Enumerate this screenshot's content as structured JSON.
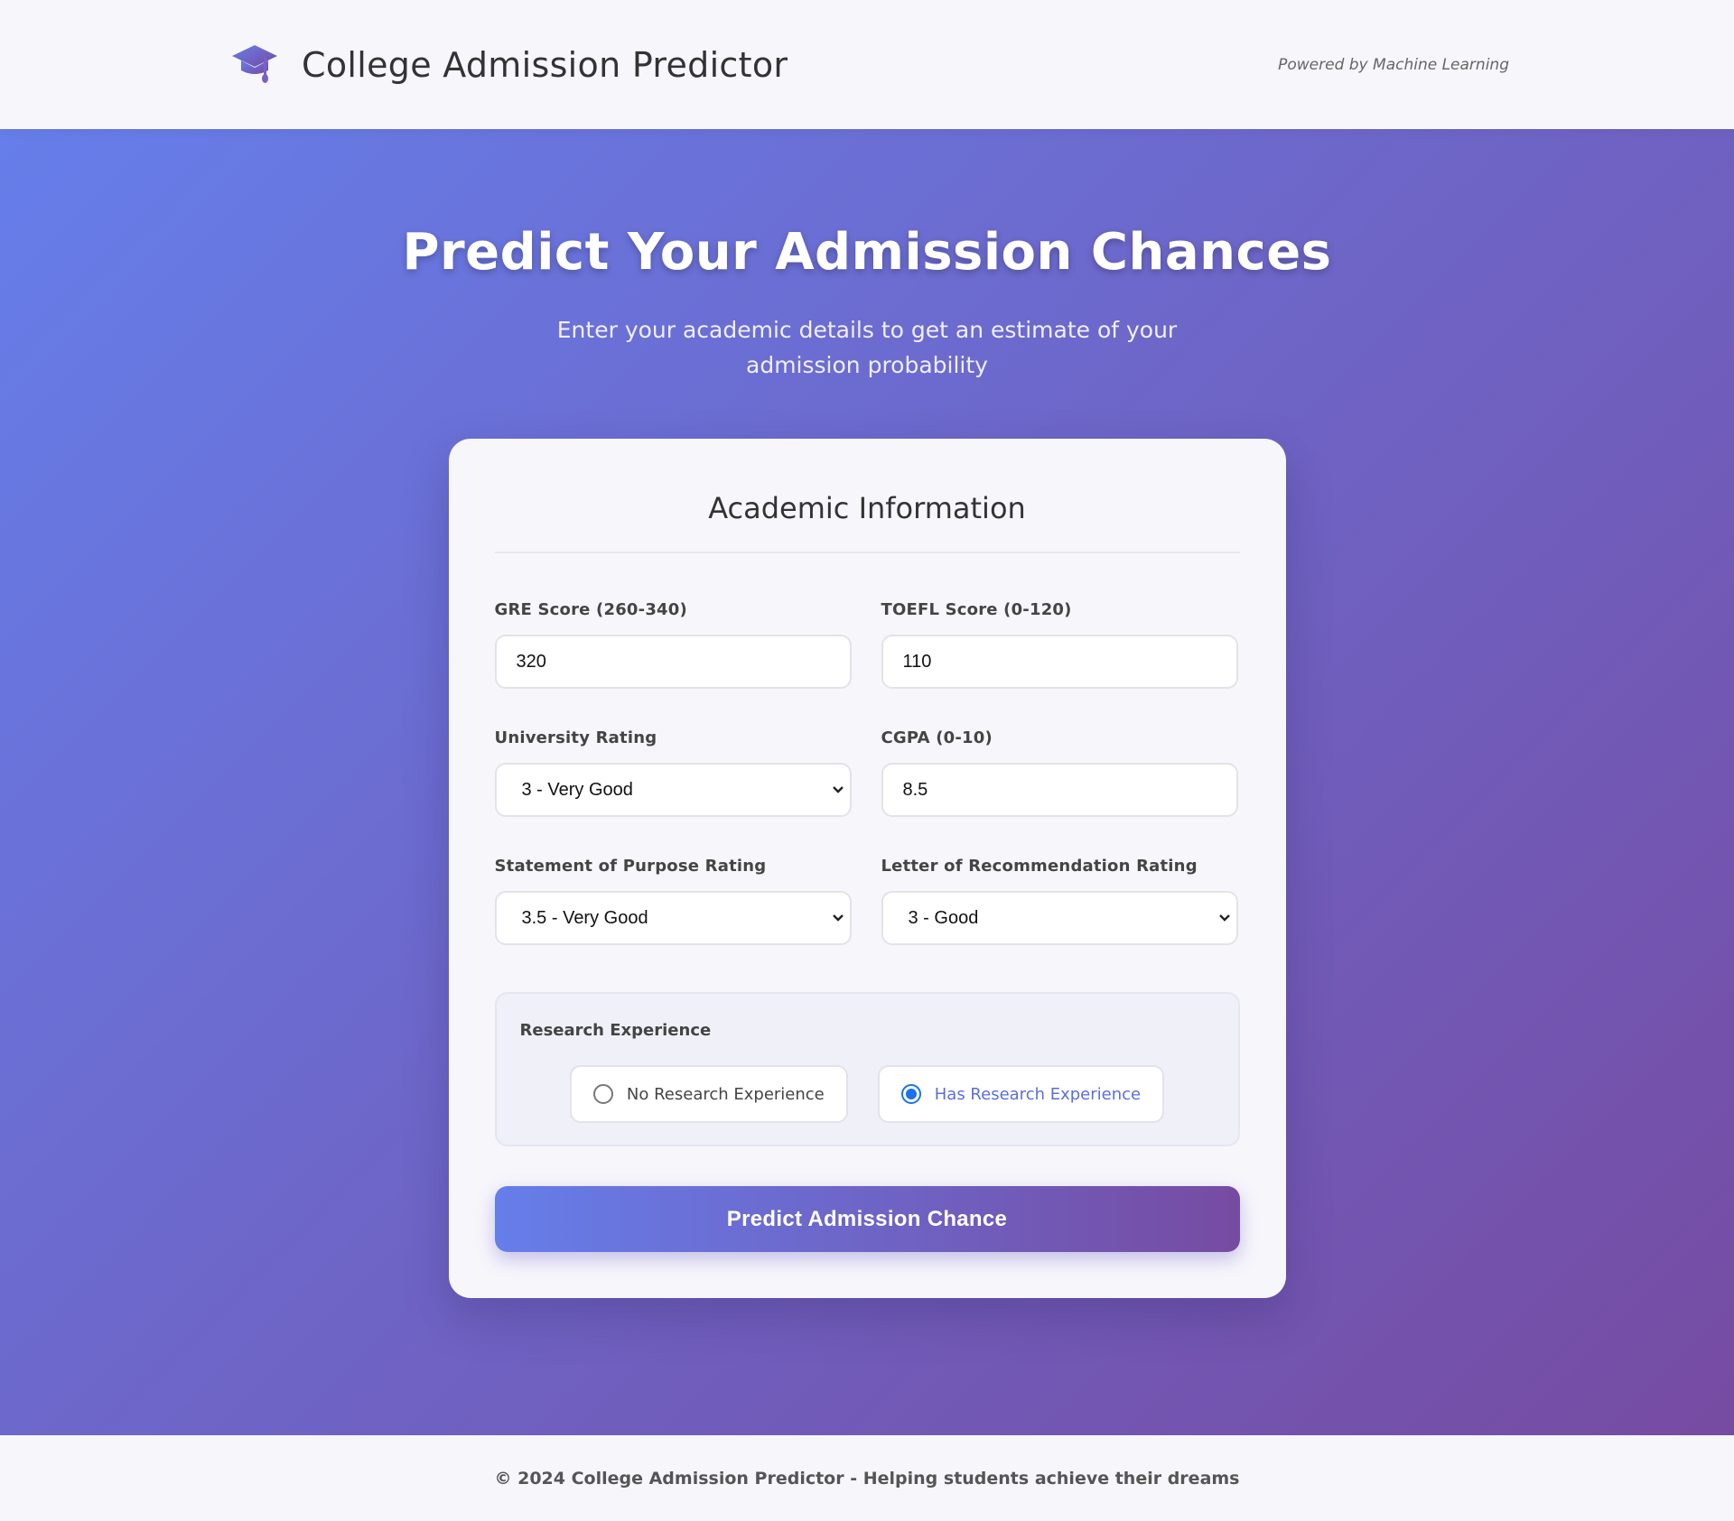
{
  "header": {
    "title": "College Admission Predictor",
    "powered": "Powered by Machine Learning",
    "icon": "graduation-cap-icon"
  },
  "hero": {
    "title": "Predict Your Admission Chances",
    "subtitle": "Enter your academic details to get an estimate of your admission probability"
  },
  "form": {
    "title": "Academic Information",
    "gre": {
      "label": "GRE Score (260-340)",
      "value": "320"
    },
    "toefl": {
      "label": "TOEFL Score (0-120)",
      "value": "110"
    },
    "university_rating": {
      "label": "University Rating",
      "value": "3 - Very Good"
    },
    "cgpa": {
      "label": "CGPA (0-10)",
      "value": "8.5"
    },
    "sop": {
      "label": "Statement of Purpose Rating",
      "value": "3.5 - Very Good"
    },
    "lor": {
      "label": "Letter of Recommendation Rating",
      "value": "3 - Good"
    },
    "research": {
      "label": "Research Experience",
      "no_label": "No Research Experience",
      "yes_label": "Has Research Experience",
      "selected": "yes"
    },
    "submit_label": "Predict Admission Chance"
  },
  "footer": {
    "text": "© 2024 College Admission Predictor - Helping students achieve their dreams"
  },
  "colors": {
    "gradient_start": "#667eea",
    "gradient_end": "#764ba2",
    "radio_accent": "#1a73e8"
  }
}
